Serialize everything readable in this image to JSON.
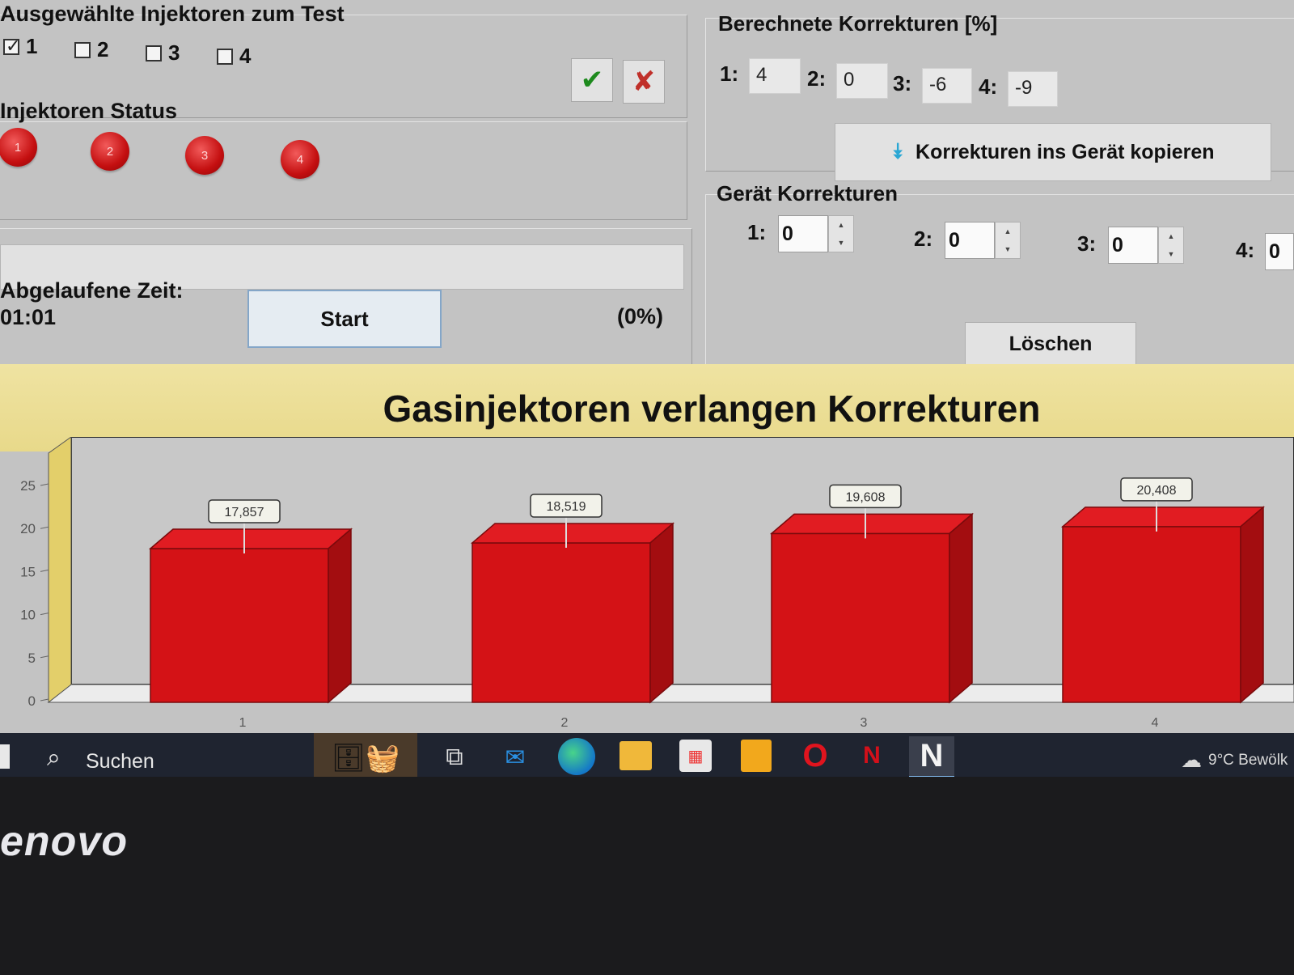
{
  "test_group": {
    "title": "Ausgewählte Injektoren zum Test",
    "checkboxes": [
      {
        "label": "1",
        "checked": true
      },
      {
        "label": "2",
        "checked": false
      },
      {
        "label": "3",
        "checked": false
      },
      {
        "label": "4",
        "checked": false
      }
    ],
    "confirm_icon": "✔",
    "cancel_icon": "✘"
  },
  "status_group": {
    "title": "Injektoren Status",
    "leds": [
      "1",
      "2",
      "3",
      "4"
    ],
    "led_color": "#d0181a"
  },
  "timer": {
    "label": "Abgelaufene Zeit:",
    "value": "01:01",
    "start_label": "Start",
    "progress_text": "(0%)",
    "progress": 0
  },
  "calculated": {
    "title": "Berechnete Korrekturen [%]",
    "items": [
      {
        "label": "1:",
        "value": "4"
      },
      {
        "label": "2:",
        "value": "0"
      },
      {
        "label": "3:",
        "value": "-6"
      },
      {
        "label": "4:",
        "value": "-9"
      }
    ],
    "copy_label": "Korrekturen ins Gerät kopieren",
    "copy_icon": "⯯"
  },
  "device": {
    "title": "Gerät Korrekturen",
    "items": [
      {
        "label": "1:",
        "value": "0"
      },
      {
        "label": "2:",
        "value": "0"
      },
      {
        "label": "3:",
        "value": "0"
      },
      {
        "label": "4:",
        "value": "0"
      }
    ],
    "clear_label": "Löschen"
  },
  "banner": {
    "text": "Gasinjektoren verlangen Korrekturen",
    "color": "#ecdc8e"
  },
  "chart_data": {
    "type": "bar",
    "categories": [
      "1",
      "2",
      "3",
      "4"
    ],
    "values": [
      17.857,
      18.519,
      19.608,
      20.408
    ],
    "data_labels": [
      "17,857",
      "18,519",
      "19,608",
      "20,408"
    ],
    "yticks": [
      "0",
      "5",
      "10",
      "15",
      "20",
      "25"
    ],
    "ylim": [
      0,
      25
    ],
    "bar_color": "#d41216",
    "grid": false,
    "style": "3d"
  },
  "taskbar": {
    "search_label": "Suchen",
    "search_icon": "search-icon",
    "weather_text": "9°C Bewölk"
  },
  "bezel": {
    "brand": "enovo"
  }
}
